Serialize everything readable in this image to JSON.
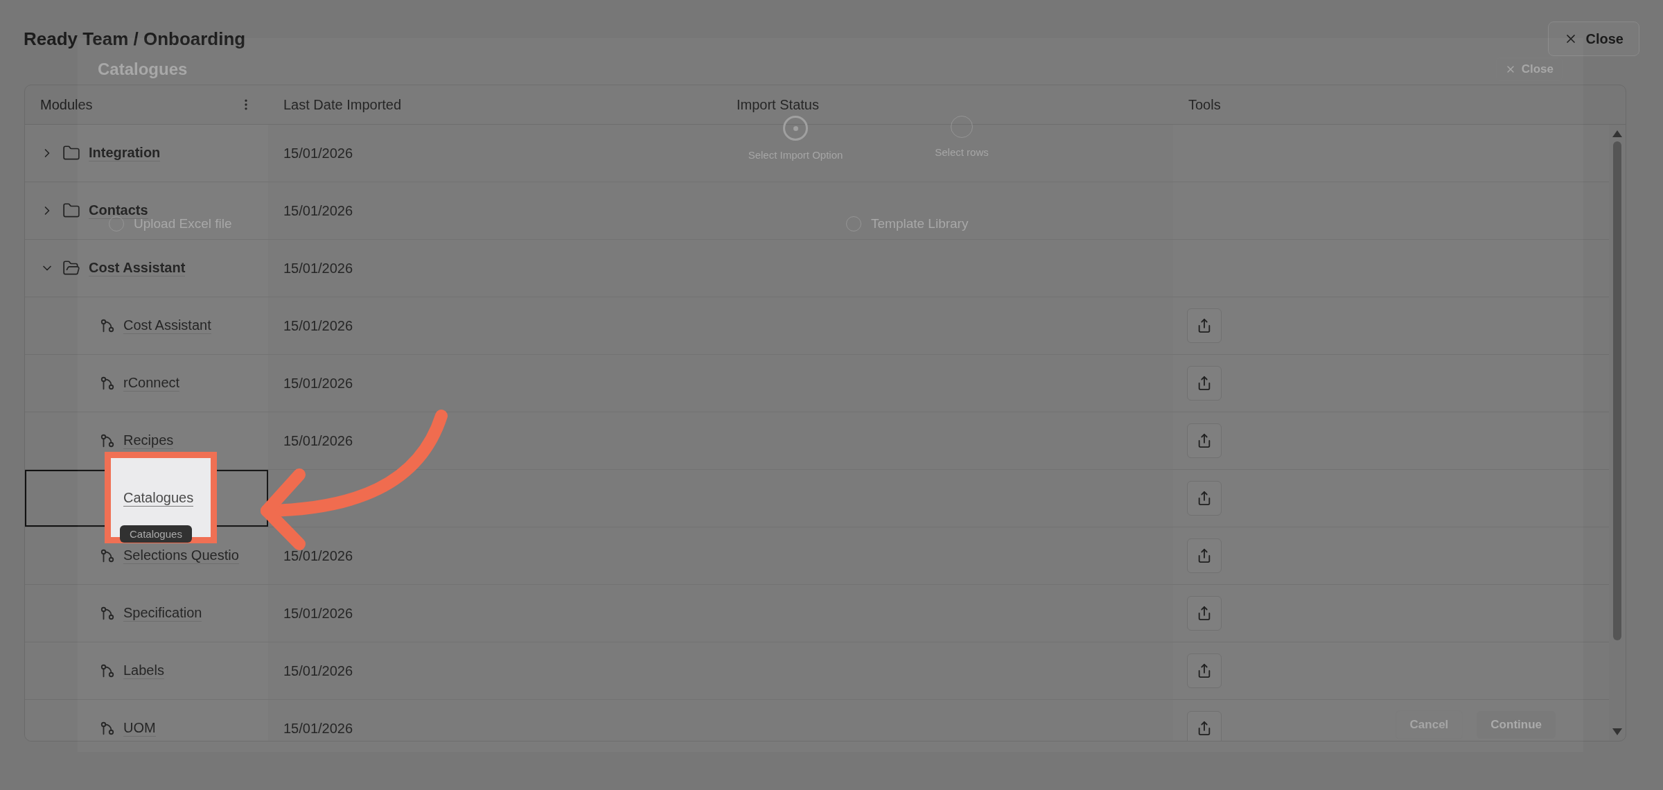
{
  "window": {
    "title": "Ready Team / Onboarding",
    "close": "Close"
  },
  "table": {
    "columns": [
      "Modules",
      "Last Date Imported",
      "Import Status",
      "Tools"
    ],
    "rows": [
      {
        "kind": "folder",
        "name": "Integration",
        "expanded": false,
        "date": "15/01/2026"
      },
      {
        "kind": "folder",
        "name": "Contacts",
        "expanded": false,
        "date": "15/01/2026"
      },
      {
        "kind": "folder",
        "name": "Cost Assistant",
        "expanded": true,
        "date": "15/01/2026"
      },
      {
        "kind": "item",
        "name": "Cost Assistant",
        "selected": false,
        "date": "15/01/2026"
      },
      {
        "kind": "item",
        "name": "rConnect",
        "selected": false,
        "date": "15/01/2026"
      },
      {
        "kind": "item",
        "name": "Recipes",
        "selected": false,
        "date": "15/01/2026"
      },
      {
        "kind": "item",
        "name": "Catalogues",
        "selected": true,
        "tooltip": "Catalogues"
      },
      {
        "kind": "item",
        "name": "Selections Questio",
        "selected": false,
        "date": "15/01/2026"
      },
      {
        "kind": "item",
        "name": "Specification",
        "selected": false,
        "date": "15/01/2026"
      },
      {
        "kind": "item",
        "name": "Labels",
        "selected": false,
        "date": "15/01/2026"
      },
      {
        "kind": "item",
        "name": "UOM",
        "selected": false,
        "date": "15/01/2026"
      }
    ]
  },
  "import_dialog": {
    "title": "Catalogues",
    "close": "Close",
    "steps": [
      {
        "label": "Select Import Option",
        "selected": true
      },
      {
        "label": "Select rows",
        "selected": false
      }
    ],
    "options": [
      {
        "label": "Upload Excel file",
        "selected": false
      },
      {
        "label": "Template Library",
        "selected": false
      }
    ],
    "cancel": "Cancel",
    "continue": "Continue"
  }
}
